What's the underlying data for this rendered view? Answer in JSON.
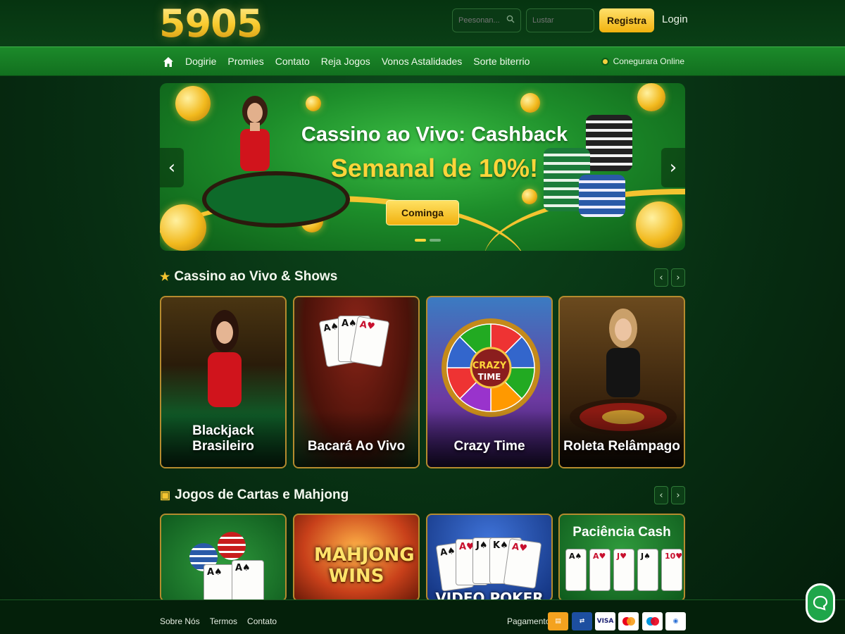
{
  "header": {
    "logo": "5905",
    "username_placeholder": "Peesonan...",
    "password_placeholder": "Lustar",
    "register_label": "Registra",
    "login_label": "Login"
  },
  "nav": {
    "items": [
      "Dogirie",
      "Promies",
      "Contato",
      "Reja Jogos",
      "Vonos Astalidades",
      "Sorte biterrio"
    ],
    "online_label": "Conegurara Online"
  },
  "banner": {
    "title": "Cassino ao Vivo: Cashback",
    "subtitle": "Semanal de 10%!",
    "cta_label": "Cominga"
  },
  "sections": [
    {
      "title": "Cassino ao Vivo & Shows",
      "icon": "star-icon",
      "cards": [
        "Blackjack Brasileiro",
        "Bacará Ao Vivo",
        "Crazy Time",
        "Roleta Relâmpago"
      ]
    },
    {
      "title": "Jogos de Cartas e Mahjong",
      "icon": "gift-icon",
      "cards": [
        "",
        "MAHJONG WINS",
        "VIDEO POKER",
        "Paciência Cash"
      ]
    }
  ],
  "crazy_time_art": [
    "CRAZY",
    "TIME"
  ],
  "footer": {
    "links": [
      "Sobre Nós",
      "Termos",
      "Contato"
    ],
    "payment_label": "Pagamento",
    "payment_methods": [
      "boleto-icon",
      "bank-transfer-icon",
      "VISA",
      "mastercard-icon",
      "maestro-icon",
      "wallet-icon"
    ]
  },
  "colors": {
    "accent_gold": "#f4c430",
    "nav_green": "#1c8a2a",
    "background": "#06290f"
  }
}
